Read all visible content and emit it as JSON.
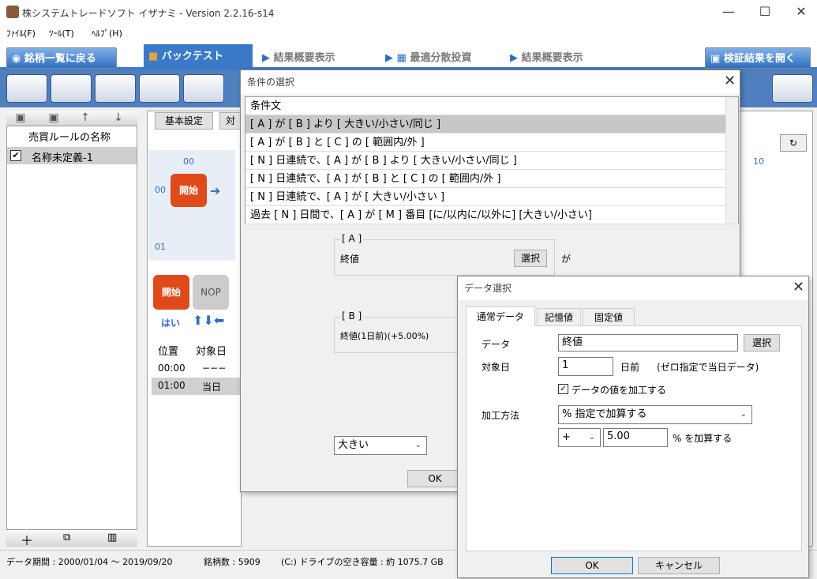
{
  "window": {
    "title": "株システムトレードソフト イザナミ - Version 2.2.16-s14",
    "minimize": "—",
    "maximize": "☐",
    "close": "✕"
  },
  "menu": [
    "ﾌｧｲﾙ(F)",
    "ﾂｰﾙ(T)",
    "ﾍﾙﾌﾟ(H)"
  ],
  "nav": {
    "back": "銘柄一覧に戻る",
    "backtest": "バックテスト",
    "summary1": "結果概要表示",
    "optimal": "最適分散投資",
    "summary2": "結果概要表示",
    "verify": "検証結果を開く"
  },
  "left_panel": {
    "header": "売買ルールの名称",
    "rows": [
      {
        "checked": "✔",
        "name": "名称未定義-1"
      }
    ]
  },
  "mid": {
    "tab_basic": "基本設定",
    "tab_other": "対",
    "col00": "00",
    "col10": "10",
    "row00": "00",
    "row01": "01",
    "start": "開始",
    "nop": "NOP",
    "yes": "はい",
    "table": {
      "headers": [
        "位置",
        "対象日"
      ],
      "rows": [
        [
          "00:00",
          "−−−"
        ],
        [
          "01:00",
          "当日"
        ]
      ]
    }
  },
  "status": {
    "period": "データ期間 : 2000/01/04 〜 2019/09/20",
    "count": "銘柄数 : 5909",
    "drive": "(C:) ドライブの空き容量 : 約 1075.7 GB"
  },
  "cond_dialog": {
    "title": "条件の選択",
    "list_header": "条件文",
    "items": [
      "[ A ] が [ B ] より [ 大きい/小さい/同じ ]",
      "[ A ] が [ B ] と [ C ] の [ 範囲内/外 ]",
      "[ N ] 日連続で、[ A ] が [ B ] より [ 大きい/小さい/同じ ]",
      "[ N ] 日連続で、[ A ] が [ B ] と [ C ] の [ 範囲内/外 ]",
      "[ N ] 日連続で、[ A ] が [ 大きい/小さい ]",
      "過去 [ N ] 日間で、[ A ] が [ M ] 番目 [に/以内に/以外に] [大きい/小さい]"
    ],
    "a_label": "[ A ]",
    "a_value": "終値",
    "a_select": "選択",
    "ga": "が",
    "b_label": "[ B ]",
    "b_value": "終値(1日前)(+5.00%)",
    "compare": "大きい",
    "ok": "OK"
  },
  "data_dialog": {
    "title": "データ選択",
    "tabs": [
      "通常データ",
      "記憶値",
      "固定値"
    ],
    "data_label": "データ",
    "data_value": "終値",
    "select": "選択",
    "day_label": "対象日",
    "day_value": "1",
    "day_unit": "日前",
    "day_note": "(ゼロ指定で当日データ)",
    "process_check": "データの値を加工する",
    "method_label": "加工方法",
    "method_value": "% 指定で加算する",
    "op_value": "+",
    "amount": "5.00",
    "amount_unit": "% を加算する",
    "ok": "OK",
    "cancel": "キャンセル"
  }
}
